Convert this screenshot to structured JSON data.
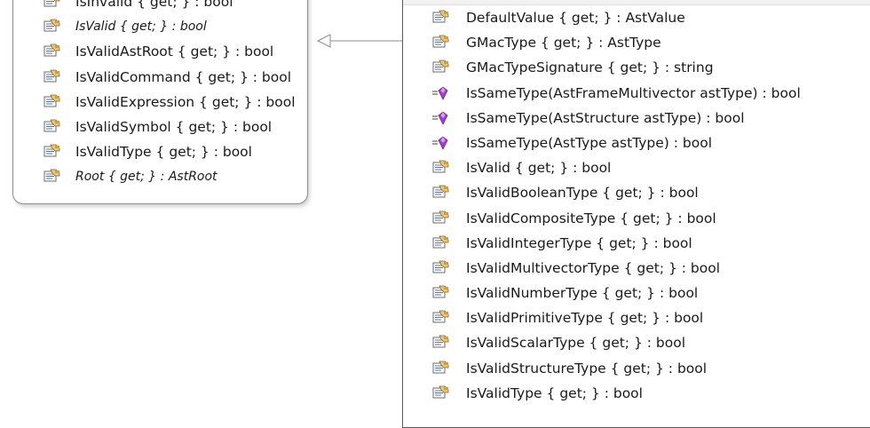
{
  "left_class": {
    "members": [
      {
        "label": "IsInvalid { get; } : bool",
        "icon": "property-icon",
        "italic": false
      },
      {
        "label": "IsValid { get; } : bool",
        "icon": "property-icon",
        "italic": true
      },
      {
        "label": "IsValidAstRoot { get; } : bool",
        "icon": "property-icon",
        "italic": false
      },
      {
        "label": "IsValidCommand { get; } : bool",
        "icon": "property-icon",
        "italic": false
      },
      {
        "label": "IsValidExpression { get; } : bool",
        "icon": "property-icon",
        "italic": false
      },
      {
        "label": "IsValidSymbol { get; } : bool",
        "icon": "property-icon",
        "italic": false
      },
      {
        "label": "IsValidType { get; } : bool",
        "icon": "property-icon",
        "italic": false
      },
      {
        "label": "Root { get; } : AstRoot",
        "icon": "property-icon",
        "italic": true
      }
    ]
  },
  "right_class": {
    "members": [
      {
        "label": "DefaultValue { get; } : AstValue",
        "icon": "property-icon"
      },
      {
        "label": "GMacType { get; } : AstType",
        "icon": "property-icon"
      },
      {
        "label": "GMacTypeSignature { get; } : string",
        "icon": "property-icon"
      },
      {
        "label": "IsSameType(AstFrameMultivector astType) : bool",
        "icon": "method-icon"
      },
      {
        "label": "IsSameType(AstStructure astType) : bool",
        "icon": "method-icon"
      },
      {
        "label": "IsSameType(AstType astType) : bool",
        "icon": "method-icon"
      },
      {
        "label": "IsValid { get; } : bool",
        "icon": "property-icon"
      },
      {
        "label": "IsValidBooleanType { get; } : bool",
        "icon": "property-icon"
      },
      {
        "label": "IsValidCompositeType { get; } : bool",
        "icon": "property-icon"
      },
      {
        "label": "IsValidIntegerType { get; } : bool",
        "icon": "property-icon"
      },
      {
        "label": "IsValidMultivectorType { get; } : bool",
        "icon": "property-icon"
      },
      {
        "label": "IsValidNumberType { get; } : bool",
        "icon": "property-icon"
      },
      {
        "label": "IsValidPrimitiveType { get; } : bool",
        "icon": "property-icon"
      },
      {
        "label": "IsValidScalarType { get; } : bool",
        "icon": "property-icon"
      },
      {
        "label": "IsValidStructureType { get; } : bool",
        "icon": "property-icon"
      },
      {
        "label": "IsValidType { get; } : bool",
        "icon": "property-icon"
      }
    ]
  },
  "colors": {
    "method_gem": "#a040c8",
    "property_hand": "#e8c878",
    "connector": "#8c8c8c"
  }
}
